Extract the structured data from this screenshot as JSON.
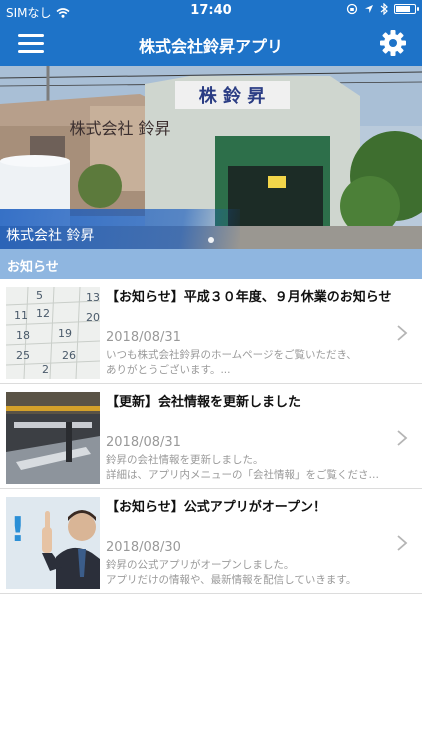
{
  "status_bar": {
    "carrier": "SIMなし",
    "time": "17:40",
    "battery_level": 0.85
  },
  "nav": {
    "title": "株式会社鈴昇アプリ",
    "menu_icon": "hamburger-menu-icon",
    "settings_icon": "gear-icon"
  },
  "hero": {
    "caption": "株式会社 鈴昇",
    "sign_text": "株 鈴 昇",
    "wall_text": "株式会社 鈴昇"
  },
  "section": {
    "label": "お知らせ"
  },
  "news": [
    {
      "title": "【お知らせ】平成３０年度、９月休業のお知らせ",
      "date": "2018/08/31",
      "body_line1": "いつも株式会社鈴昇のホームページをご覧いただき、",
      "body_line2": "ありがとうございます。..."
    },
    {
      "title": "【更新】会社情報を更新しました",
      "date": "2018/08/31",
      "body_line1": "鈴昇の会社情報を更新しました。",
      "body_line2": "詳細は、アプリ内メニューの「会社情報」をご覧ください。"
    },
    {
      "title": "【お知らせ】公式アプリがオープン！",
      "date": "2018/08/30",
      "body_line1": "鈴昇の公式アプリがオープンしました。",
      "body_line2": "アプリだけの情報や、最新情報を配信していきます。"
    }
  ],
  "colors": {
    "nav_blue": "#1e73c8",
    "section_blue": "#8fb6e0"
  }
}
